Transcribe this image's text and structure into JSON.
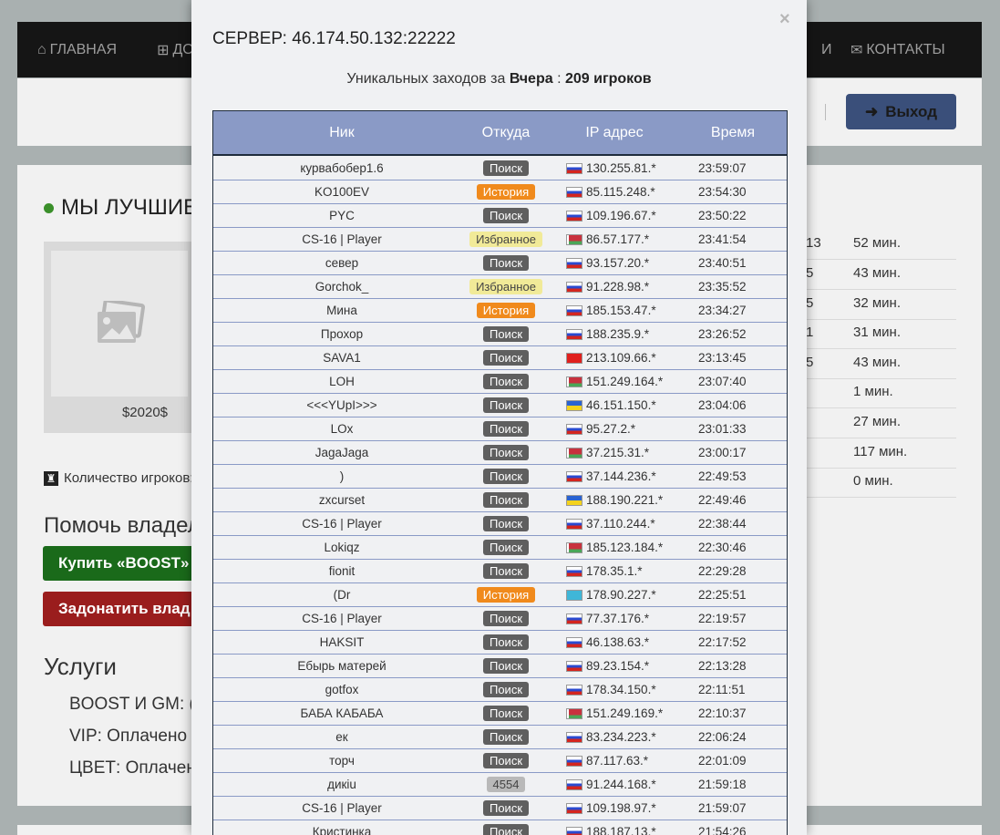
{
  "nav": {
    "home": "ГЛАВНАЯ",
    "add_partial": "ДО",
    "partial2": "И",
    "contacts": "КОНТАКТЫ",
    "logout": "Выход"
  },
  "page": {
    "best_title": "МЫ ЛУЧШИЕ",
    "price": "$2020$",
    "players_label": "Количество игроков:",
    "help_title": "Помочь владел",
    "boost_button": "Купить «BOOST»",
    "donate_button": "Задонатить влад",
    "services_title": "Услуги",
    "services": [
      {
        "text": "BOOST И GM:   ("
      },
      {
        "text": "VIP:   Оплачено"
      },
      {
        "text": "ЦВЕТ:   Оплачен"
      }
    ],
    "right_rows": [
      {
        "a": "13",
        "b": "52 мин."
      },
      {
        "a": "5",
        "b": "43 мин."
      },
      {
        "a": "5",
        "b": "32 мин."
      },
      {
        "a": "1",
        "b": "31 мин."
      },
      {
        "a": "5",
        "b": "43 мин."
      },
      {
        "a": "",
        "b": "1 мин."
      },
      {
        "a": "",
        "b": "27 мин."
      },
      {
        "a": "",
        "b": "117 мин."
      },
      {
        "a": "",
        "b": "0 мин."
      }
    ]
  },
  "modal": {
    "title": "СЕРВЕР: 46.174.50.132:22222",
    "close": "×",
    "visits_prefix": "Уникальных заходов за",
    "visits_period": "Вчера",
    "visits_sep": ":",
    "visits_count": "209 игроков",
    "headers": {
      "nick": "Ник",
      "from": "Откуда",
      "ip": "IP адрес",
      "time": "Время"
    },
    "rows": [
      {
        "nick": "курвабобер1.6",
        "from": "Поиск",
        "type": "search",
        "flag": "ru",
        "ip": "130.255.81.*",
        "time": "23:59:07"
      },
      {
        "nick": "KO100EV",
        "from": "История",
        "type": "history",
        "flag": "ru",
        "ip": "85.115.248.*",
        "time": "23:54:30"
      },
      {
        "nick": "PYC",
        "from": "Поиск",
        "type": "search",
        "flag": "ru",
        "ip": "109.196.67.*",
        "time": "23:50:22"
      },
      {
        "nick": "CS-16 | Player",
        "from": "Избранное",
        "type": "fav",
        "flag": "by",
        "ip": "86.57.177.*",
        "time": "23:41:54"
      },
      {
        "nick": "север",
        "from": "Поиск",
        "type": "search",
        "flag": "ru",
        "ip": "93.157.20.*",
        "time": "23:40:51"
      },
      {
        "nick": "Gorchok_",
        "from": "Избранное",
        "type": "fav",
        "flag": "ru",
        "ip": "91.228.98.*",
        "time": "23:35:52"
      },
      {
        "nick": "Мина",
        "from": "История",
        "type": "history",
        "flag": "ru",
        "ip": "185.153.47.*",
        "time": "23:34:27"
      },
      {
        "nick": "Прохор",
        "from": "Поиск",
        "type": "search",
        "flag": "ru",
        "ip": "188.235.9.*",
        "time": "23:26:52"
      },
      {
        "nick": "SAVA1",
        "from": "Поиск",
        "type": "search",
        "flag": "kg",
        "ip": "213.109.66.*",
        "time": "23:13:45"
      },
      {
        "nick": "LOH",
        "from": "Поиск",
        "type": "search",
        "flag": "by",
        "ip": "151.249.164.*",
        "time": "23:07:40"
      },
      {
        "nick": "<<<YUpI>>>",
        "from": "Поиск",
        "type": "search",
        "flag": "ua",
        "ip": "46.151.150.*",
        "time": "23:04:06"
      },
      {
        "nick": "LOx",
        "from": "Поиск",
        "type": "search",
        "flag": "ru",
        "ip": "95.27.2.*",
        "time": "23:01:33"
      },
      {
        "nick": "JagaJaga",
        "from": "Поиск",
        "type": "search",
        "flag": "by",
        "ip": "37.215.31.*",
        "time": "23:00:17"
      },
      {
        "nick": ")",
        "from": "Поиск",
        "type": "search",
        "flag": "ru",
        "ip": "37.144.236.*",
        "time": "22:49:53"
      },
      {
        "nick": "zxcurset",
        "from": "Поиск",
        "type": "search",
        "flag": "ua",
        "ip": "188.190.221.*",
        "time": "22:49:46"
      },
      {
        "nick": "CS-16 | Player",
        "from": "Поиск",
        "type": "search",
        "flag": "ru",
        "ip": "37.110.244.*",
        "time": "22:38:44"
      },
      {
        "nick": "Lokiqz",
        "from": "Поиск",
        "type": "search",
        "flag": "by",
        "ip": "185.123.184.*",
        "time": "22:30:46"
      },
      {
        "nick": "fionit",
        "from": "Поиск",
        "type": "search",
        "flag": "ru",
        "ip": "178.35.1.*",
        "time": "22:29:28"
      },
      {
        "nick": "(Dr",
        "from": "История",
        "type": "history",
        "flag": "kz",
        "ip": "178.90.227.*",
        "time": "22:25:51"
      },
      {
        "nick": "CS-16 | Player",
        "from": "Поиск",
        "type": "search",
        "flag": "ru",
        "ip": "77.37.176.*",
        "time": "22:19:57"
      },
      {
        "nick": "HAKSIT",
        "from": "Поиск",
        "type": "search",
        "flag": "ru",
        "ip": "46.138.63.*",
        "time": "22:17:52"
      },
      {
        "nick": "Ебырь матерей",
        "from": "Поиск",
        "type": "search",
        "flag": "ru",
        "ip": "89.23.154.*",
        "time": "22:13:28"
      },
      {
        "nick": "gotfox",
        "from": "Поиск",
        "type": "search",
        "flag": "ru",
        "ip": "178.34.150.*",
        "time": "22:11:51"
      },
      {
        "nick": "БАБА КАБАБА",
        "from": "Поиск",
        "type": "search",
        "flag": "by",
        "ip": "151.249.169.*",
        "time": "22:10:37"
      },
      {
        "nick": "ек",
        "from": "Поиск",
        "type": "search",
        "flag": "ru",
        "ip": "83.234.223.*",
        "time": "22:06:24"
      },
      {
        "nick": "торч",
        "from": "Поиск",
        "type": "search",
        "flag": "ru",
        "ip": "87.117.63.*",
        "time": "22:01:09"
      },
      {
        "nick": "дикiu",
        "from": "4554",
        "type": "num",
        "flag": "ru",
        "ip": "91.244.168.*",
        "time": "21:59:18"
      },
      {
        "nick": "CS-16 | Player",
        "from": "Поиск",
        "type": "search",
        "flag": "ru",
        "ip": "109.198.97.*",
        "time": "21:59:07"
      },
      {
        "nick": "Кристинка",
        "from": "Поиск",
        "type": "search",
        "flag": "ru",
        "ip": "188.187.13.*",
        "time": "21:54:26"
      }
    ]
  }
}
